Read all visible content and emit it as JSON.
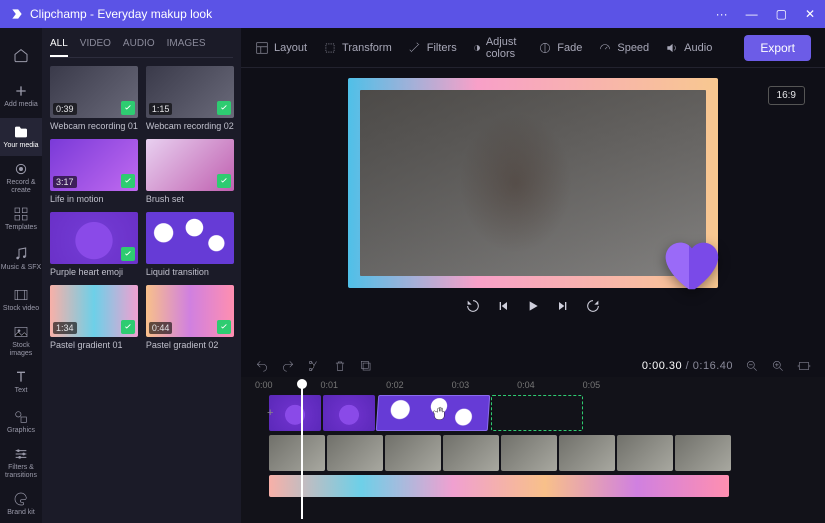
{
  "titlebar": {
    "app": "Clipchamp",
    "project": "Everyday makup look",
    "more": "···",
    "min": "—",
    "max": "▢",
    "close": "✕"
  },
  "nav": {
    "home": "",
    "add": "Add media",
    "your": "Your media",
    "record": "Record & create",
    "templates": "Templates",
    "music": "Music & SFX",
    "stockvideo": "Stock video",
    "stockimages": "Stock images",
    "text": "Text",
    "graphics": "Graphics",
    "transitions": "Filters & transitions",
    "brand": "Brand kit"
  },
  "tabs": {
    "all": "ALL",
    "video": "VIDEO",
    "audio": "AUDIO",
    "images": "IMAGES"
  },
  "clips": [
    {
      "name": "Webcam recording 01",
      "dur": "0:39"
    },
    {
      "name": "Webcam recording 02",
      "dur": "1:15"
    },
    {
      "name": "Life in motion",
      "dur": "3:17"
    },
    {
      "name": "Brush set",
      "dur": ""
    },
    {
      "name": "Purple heart emoji",
      "dur": ""
    },
    {
      "name": "Liquid transition",
      "dur": ""
    },
    {
      "name": "Pastel gradient 01",
      "dur": "1:34"
    },
    {
      "name": "Pastel gradient 02",
      "dur": "0:44"
    }
  ],
  "toolbar": {
    "layout": "Layout",
    "transform": "Transform",
    "filters": "Filters",
    "adjust": "Adjust colors",
    "fade": "Fade",
    "speed": "Speed",
    "audio": "Audio",
    "export": "Export"
  },
  "aspect": "16:9",
  "time": {
    "current": "0:00.30",
    "total": "0:16.40",
    "sep": " / "
  },
  "ruler": [
    "0:00",
    "0:01",
    "0:02",
    "0:03",
    "0:04",
    "0:05"
  ]
}
